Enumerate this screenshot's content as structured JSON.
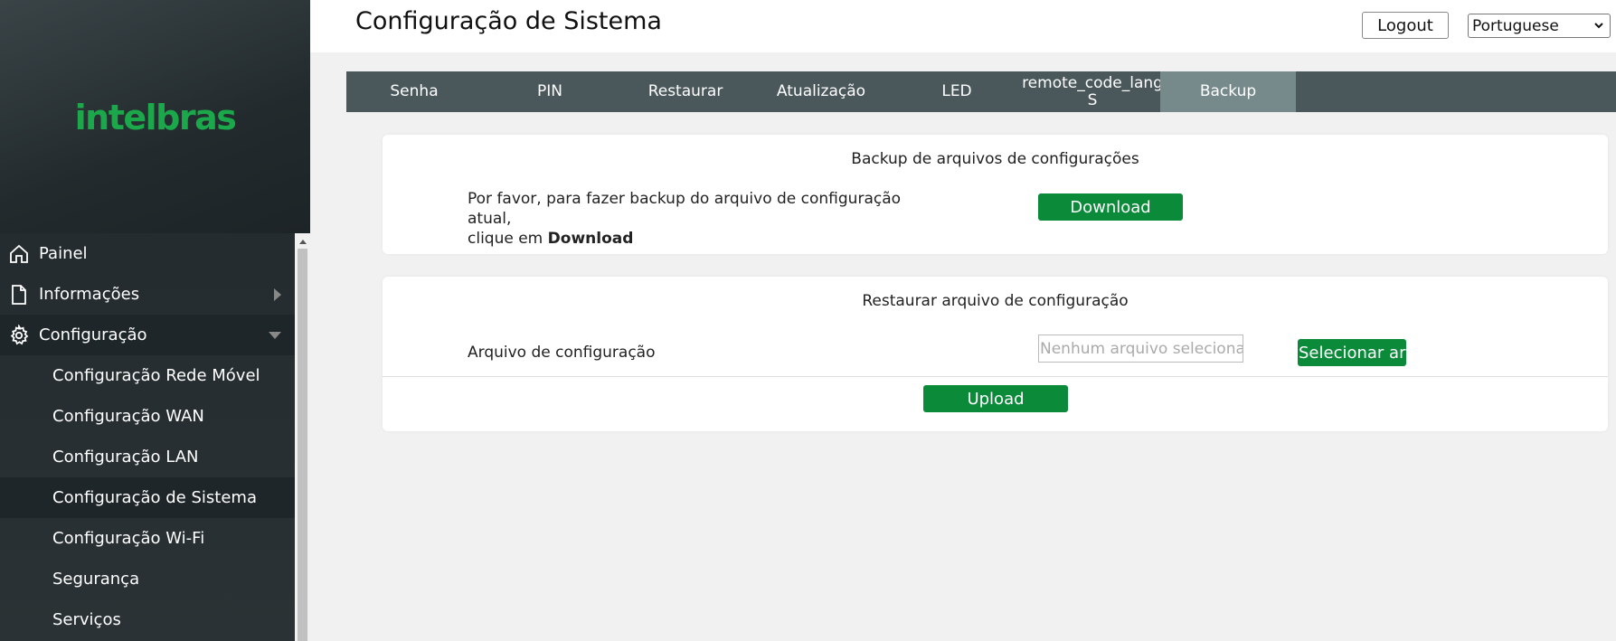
{
  "brand": {
    "logo_text": "intelbras",
    "logo_color": "#1aa84a"
  },
  "sidebar": {
    "items": [
      {
        "label": "Painel",
        "icon": "home-icon"
      },
      {
        "label": "Informações",
        "icon": "document-icon"
      },
      {
        "label": "Configuração",
        "icon": "gear-icon"
      }
    ],
    "sub_items": [
      "Configuração Rede Móvel",
      "Configuração WAN",
      "Configuração LAN",
      "Configuração de Sistema",
      "Configuração Wi-Fi",
      "Segurança",
      "Serviços"
    ],
    "selected_sub_item": "Configuração de Sistema"
  },
  "header": {
    "title": "Configuração de Sistema",
    "logout_label": "Logout",
    "language": "Portuguese"
  },
  "tabs": {
    "items": [
      "Senha",
      "PIN",
      "Restaurar",
      "Atualização",
      "LED",
      "remote_code_lang S",
      "Backup"
    ],
    "active": "Backup"
  },
  "backup_card": {
    "title": "Backup de arquivos de configurações",
    "desc_line1": "Por favor, para fazer backup do arquivo de configuração atual,",
    "desc_line2_prefix": "clique em",
    "desc_line2_bold": "Download",
    "download_label": "Download"
  },
  "restore_card": {
    "title": "Restaurar arquivo de configuração",
    "file_label": "Arquivo de configuração",
    "file_placeholder": "Nenhum arquivo selecionado",
    "select_label": "Selecionar arqu",
    "upload_label": "Upload"
  },
  "colors": {
    "accent_green": "#0b8a3a",
    "sidebar_bg": "#242b2e",
    "tab_bar": "#4a575b",
    "tab_active": "#768a8c"
  }
}
